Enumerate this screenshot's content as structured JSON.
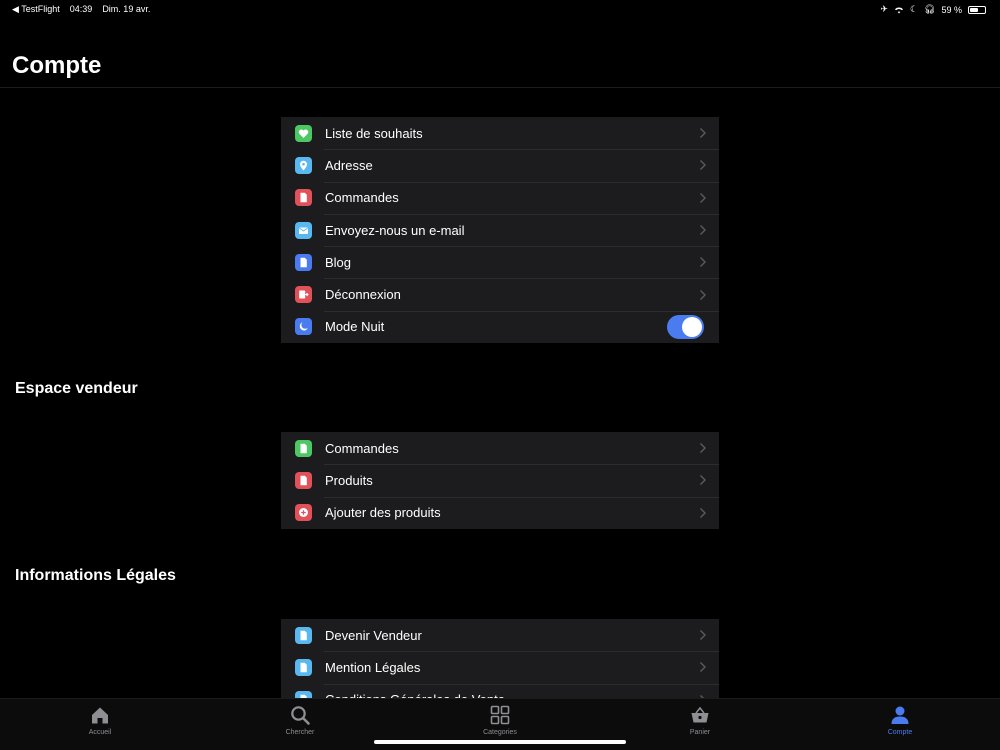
{
  "status_bar": {
    "back_app": "◀ TestFlight",
    "time": "04:39",
    "date": "Dim. 19 avr.",
    "battery": "59 %",
    "battery_level": 0.59
  },
  "page_title": "Compte",
  "account_group": [
    {
      "label": "Liste de souhaits",
      "icon": "heart-icon",
      "color": "#4cc764"
    },
    {
      "label": "Adresse",
      "icon": "location-icon",
      "color": "#5ab8f0"
    },
    {
      "label": "Commandes",
      "icon": "document-icon",
      "color": "#e0515a"
    },
    {
      "label": "Envoyez-nous un e-mail",
      "icon": "mail-icon",
      "color": "#5ab8f0"
    },
    {
      "label": "Blog",
      "icon": "document-icon",
      "color": "#4a7cf0"
    },
    {
      "label": "Déconnexion",
      "icon": "logout-icon",
      "color": "#e0515a"
    },
    {
      "label": "Mode Nuit",
      "icon": "moon-icon",
      "color": "#4a7cf0",
      "toggle_on": true
    }
  ],
  "seller_title": "Espace vendeur",
  "seller_group": [
    {
      "label": "Commandes",
      "icon": "document-icon",
      "color": "#4cc764"
    },
    {
      "label": "Produits",
      "icon": "document-icon",
      "color": "#e0515a"
    },
    {
      "label": "Ajouter des produits",
      "icon": "plus-circle-icon",
      "color": "#e0515a"
    }
  ],
  "legal_title": "Informations Légales",
  "legal_group": [
    {
      "label": "Devenir Vendeur",
      "icon": "document-icon",
      "color": "#5ab8f0"
    },
    {
      "label": "Mention Légales",
      "icon": "document-icon",
      "color": "#5ab8f0"
    },
    {
      "label": "Conditions Générales de Vente",
      "icon": "document-icon",
      "color": "#5ab8f0"
    }
  ],
  "tabs": [
    {
      "label": "Accueil",
      "icon": "home-icon"
    },
    {
      "label": "Chercher",
      "icon": "search-icon"
    },
    {
      "label": "Categories",
      "icon": "grid-icon"
    },
    {
      "label": "Panier",
      "icon": "basket-icon"
    },
    {
      "label": "Compte",
      "icon": "user-icon",
      "active": true
    }
  ],
  "colors": {
    "accent": "#4a7cf0",
    "inactive_tab": "#8e8e93",
    "group_bg": "#1c1c1e"
  }
}
